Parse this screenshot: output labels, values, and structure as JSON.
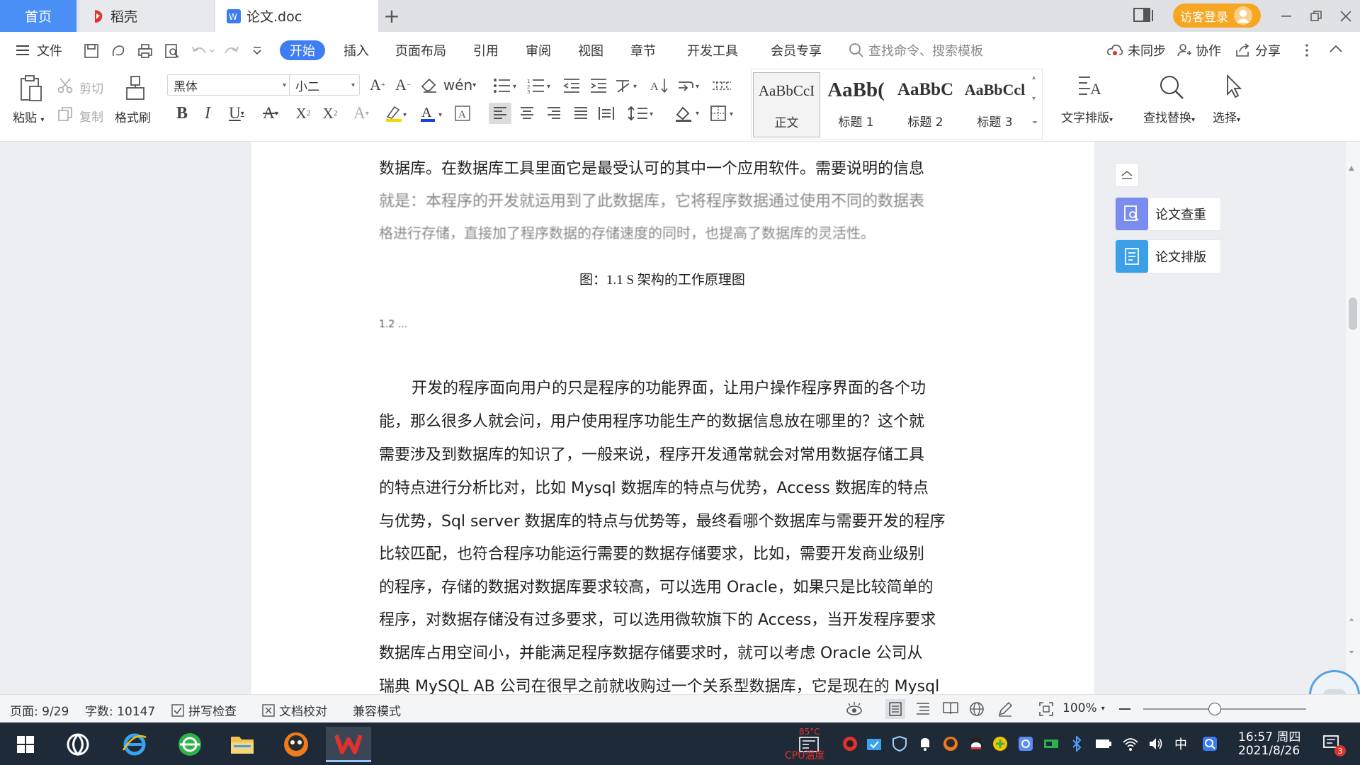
{
  "tabs": {
    "home": "首页",
    "daoke": "稻壳",
    "doc": "论文.doc",
    "new_tab": "+"
  },
  "window": {
    "login": "访客登录"
  },
  "menu": {
    "file": "文件",
    "items": [
      "开始",
      "插入",
      "页面布局",
      "引用",
      "审阅",
      "视图",
      "章节",
      "开发工具",
      "会员专享"
    ],
    "search_placeholder": "查找命令、搜索模板",
    "sync": "未同步",
    "collab": "协作",
    "share": "分享"
  },
  "ribbon": {
    "paste": "粘贴",
    "cut": "剪切",
    "copy": "复制",
    "format_painter": "格式刷",
    "font_name": "黑体",
    "font_size": "小二",
    "styles": [
      {
        "sample": "AaBbCcI",
        "label": "正文"
      },
      {
        "sample": "AaBb(",
        "label": "标题 1"
      },
      {
        "sample": "AaBbC",
        "label": "标题 2"
      },
      {
        "sample": "AaBbCcl",
        "label": "标题 3"
      }
    ],
    "text_layout": "文字排版",
    "find_replace": "查找替换",
    "select": "选择"
  },
  "document": {
    "lines_top": [
      "数据库。在数据库工具里面它是最受认可的其中一个应用软件。需要说明的信息",
      "就是：本程序的开发就运用到了此数据库，它将程序数据通过使用不同的数据表",
      "格进行存储，直接加了程序数据的存储速度的同时，也提高了数据库的灵活性。"
    ],
    "caption": "图：1.1 S 架构的工作原理图",
    "heading_fragment": "1.2 ...",
    "body_lines": [
      "开发的程序面向用户的只是程序的功能界面，让用户操作程序界面的各个功",
      "能，那么很多人就会问，用户使用程序功能生产的数据信息放在哪里的？这个就",
      "需要涉及到数据库的知识了，一般来说，程序开发通常就会对常用数据存储工具",
      "的特点进行分析比对，比如 Mysql 数据库的特点与优势，Access 数据库的特点",
      "与优势，Sql server 数据库的特点与优势等，最终看哪个数据库与需要开发的程序",
      "比较匹配，也符合程序功能运行需要的数据存储要求，比如，需要开发商业级别",
      "的程序，存储的数据对数据库要求较高，可以选用 Oracle，如果只是比较简单的",
      "程序，对数据存储没有过多要求，可以选用微软旗下的 Access，当开发程序要求",
      "数据库占用空间小，并能满足程序数据存储要求时，就可以考虑 Oracle 公司从",
      "瑞典 MySQL AB 公司在很早之前就收购过一个关系型数据库，它是现在的 Mysql"
    ]
  },
  "side_panel": {
    "check": "论文查重",
    "format": "论文排版"
  },
  "status": {
    "page": "页面: 9/29",
    "words": "字数: 10147",
    "spell": "拼写检查",
    "proof": "文档校对",
    "compat": "兼容模式",
    "zoom": "100%"
  },
  "taskbar": {
    "cpu": "CPU温度",
    "cpu_temp": "85°C",
    "ime": "中",
    "time": "16:57 周四",
    "date": "2021/8/26",
    "notifications": "3"
  },
  "colors": {
    "accent": "#3f7ef2",
    "login": "#f5a623",
    "wps_red": "#e0322d"
  }
}
